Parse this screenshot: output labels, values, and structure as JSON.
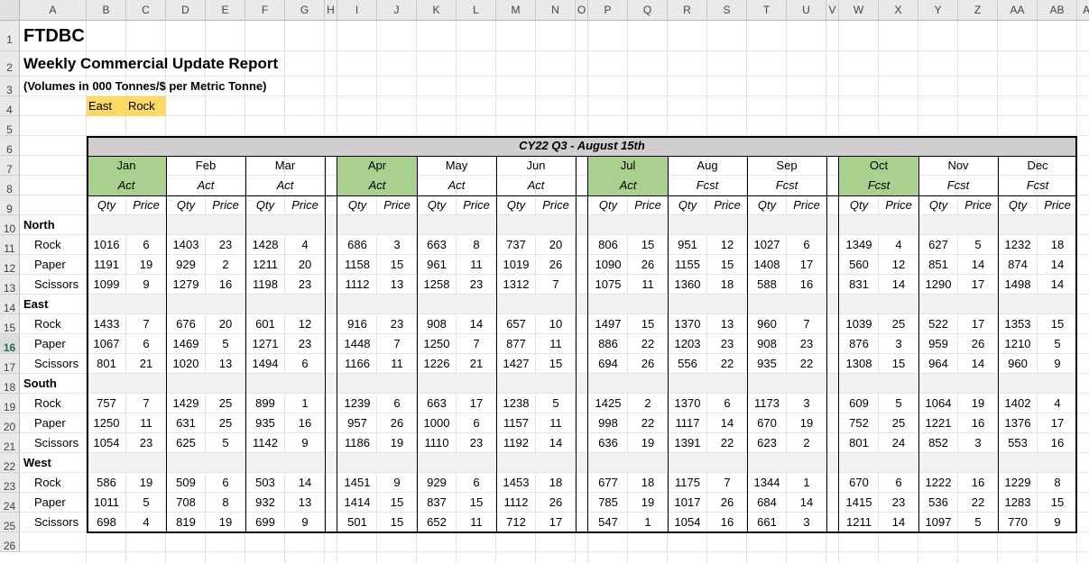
{
  "columns": [
    "A",
    "B",
    "C",
    "D",
    "E",
    "F",
    "G",
    "H",
    "I",
    "J",
    "K",
    "L",
    "M",
    "N",
    "O",
    "P",
    "Q",
    "R",
    "S",
    "T",
    "U",
    "V",
    "W",
    "X",
    "Y",
    "Z",
    "AA",
    "AB",
    "AC"
  ],
  "row_numbers": [
    "1",
    "2",
    "3",
    "4",
    "5",
    "6",
    "7",
    "8",
    "9",
    "10",
    "11",
    "12",
    "13",
    "14",
    "15",
    "16",
    "17",
    "18",
    "19",
    "20",
    "21",
    "22",
    "23",
    "24",
    "25",
    "26"
  ],
  "selected_row": "16",
  "title": "FTDBC",
  "subtitle": "Weekly Commercial Update Report",
  "units_note": "(Volumes in 000 Tonnes/$ per Metric Tonne)",
  "filters": [
    "East",
    "Rock"
  ],
  "banner": "CY22 Q3 - August 15th",
  "months": [
    {
      "name": "Jan",
      "type": "Act",
      "highlight": true
    },
    {
      "name": "Feb",
      "type": "Act",
      "highlight": false
    },
    {
      "name": "Mar",
      "type": "Act",
      "highlight": false
    },
    {
      "name": "Apr",
      "type": "Act",
      "highlight": true
    },
    {
      "name": "May",
      "type": "Act",
      "highlight": false
    },
    {
      "name": "Jun",
      "type": "Act",
      "highlight": false
    },
    {
      "name": "Jul",
      "type": "Act",
      "highlight": true
    },
    {
      "name": "Aug",
      "type": "Fcst",
      "highlight": false
    },
    {
      "name": "Sep",
      "type": "Fcst",
      "highlight": false
    },
    {
      "name": "Oct",
      "type": "Fcst",
      "highlight": true
    },
    {
      "name": "Nov",
      "type": "Fcst",
      "highlight": false
    },
    {
      "name": "Dec",
      "type": "Fcst",
      "highlight": false
    }
  ],
  "qty_label": "Qty",
  "price_label": "Price",
  "regions": [
    {
      "name": "North",
      "rows": [
        {
          "product": "Rock",
          "values": [
            [
              1016,
              6
            ],
            [
              1403,
              23
            ],
            [
              1428,
              4
            ],
            [
              686,
              3
            ],
            [
              663,
              8
            ],
            [
              737,
              20
            ],
            [
              806,
              15
            ],
            [
              951,
              12
            ],
            [
              1027,
              6
            ],
            [
              1349,
              4
            ],
            [
              627,
              5
            ],
            [
              1232,
              18
            ]
          ]
        },
        {
          "product": "Paper",
          "values": [
            [
              1191,
              19
            ],
            [
              929,
              2
            ],
            [
              1211,
              20
            ],
            [
              1158,
              15
            ],
            [
              961,
              11
            ],
            [
              1019,
              26
            ],
            [
              1090,
              26
            ],
            [
              1155,
              15
            ],
            [
              1408,
              17
            ],
            [
              560,
              12
            ],
            [
              851,
              14
            ],
            [
              874,
              14
            ]
          ]
        },
        {
          "product": "Scissors",
          "values": [
            [
              1099,
              9
            ],
            [
              1279,
              16
            ],
            [
              1198,
              23
            ],
            [
              1112,
              13
            ],
            [
              1258,
              23
            ],
            [
              1312,
              7
            ],
            [
              1075,
              11
            ],
            [
              1360,
              18
            ],
            [
              588,
              16
            ],
            [
              831,
              14
            ],
            [
              1290,
              17
            ],
            [
              1498,
              14
            ]
          ]
        }
      ]
    },
    {
      "name": "East",
      "rows": [
        {
          "product": "Rock",
          "values": [
            [
              1433,
              7
            ],
            [
              676,
              20
            ],
            [
              601,
              12
            ],
            [
              916,
              23
            ],
            [
              908,
              14
            ],
            [
              657,
              10
            ],
            [
              1497,
              15
            ],
            [
              1370,
              13
            ],
            [
              960,
              7
            ],
            [
              1039,
              25
            ],
            [
              522,
              17
            ],
            [
              1353,
              15
            ]
          ]
        },
        {
          "product": "Paper",
          "values": [
            [
              1067,
              6
            ],
            [
              1469,
              5
            ],
            [
              1271,
              23
            ],
            [
              1448,
              7
            ],
            [
              1250,
              7
            ],
            [
              877,
              11
            ],
            [
              886,
              22
            ],
            [
              1203,
              23
            ],
            [
              908,
              23
            ],
            [
              876,
              3
            ],
            [
              959,
              26
            ],
            [
              1210,
              5
            ]
          ]
        },
        {
          "product": "Scissors",
          "values": [
            [
              801,
              21
            ],
            [
              1020,
              13
            ],
            [
              1494,
              6
            ],
            [
              1166,
              11
            ],
            [
              1226,
              21
            ],
            [
              1427,
              15
            ],
            [
              694,
              26
            ],
            [
              556,
              22
            ],
            [
              935,
              22
            ],
            [
              1308,
              15
            ],
            [
              964,
              14
            ],
            [
              960,
              9
            ]
          ]
        }
      ]
    },
    {
      "name": "South",
      "rows": [
        {
          "product": "Rock",
          "values": [
            [
              757,
              7
            ],
            [
              1429,
              25
            ],
            [
              899,
              1
            ],
            [
              1239,
              6
            ],
            [
              663,
              17
            ],
            [
              1238,
              5
            ],
            [
              1425,
              2
            ],
            [
              1370,
              6
            ],
            [
              1173,
              3
            ],
            [
              609,
              5
            ],
            [
              1064,
              19
            ],
            [
              1402,
              4
            ]
          ]
        },
        {
          "product": "Paper",
          "values": [
            [
              1250,
              11
            ],
            [
              631,
              25
            ],
            [
              935,
              16
            ],
            [
              957,
              26
            ],
            [
              1000,
              6
            ],
            [
              1157,
              11
            ],
            [
              998,
              22
            ],
            [
              1117,
              14
            ],
            [
              670,
              19
            ],
            [
              752,
              25
            ],
            [
              1221,
              16
            ],
            [
              1376,
              17
            ]
          ]
        },
        {
          "product": "Scissors",
          "values": [
            [
              1054,
              23
            ],
            [
              625,
              5
            ],
            [
              1142,
              9
            ],
            [
              1186,
              19
            ],
            [
              1110,
              23
            ],
            [
              1192,
              14
            ],
            [
              636,
              19
            ],
            [
              1391,
              22
            ],
            [
              623,
              2
            ],
            [
              801,
              24
            ],
            [
              852,
              3
            ],
            [
              553,
              16
            ]
          ]
        }
      ]
    },
    {
      "name": "West",
      "rows": [
        {
          "product": "Rock",
          "values": [
            [
              586,
              19
            ],
            [
              509,
              6
            ],
            [
              503,
              14
            ],
            [
              1451,
              9
            ],
            [
              929,
              6
            ],
            [
              1453,
              18
            ],
            [
              677,
              18
            ],
            [
              1175,
              7
            ],
            [
              1344,
              1
            ],
            [
              670,
              6
            ],
            [
              1222,
              16
            ],
            [
              1229,
              8
            ]
          ]
        },
        {
          "product": "Paper",
          "values": [
            [
              1011,
              5
            ],
            [
              708,
              8
            ],
            [
              932,
              13
            ],
            [
              1414,
              15
            ],
            [
              837,
              15
            ],
            [
              1112,
              26
            ],
            [
              785,
              19
            ],
            [
              1017,
              26
            ],
            [
              684,
              14
            ],
            [
              1415,
              23
            ],
            [
              536,
              22
            ],
            [
              1283,
              15
            ]
          ]
        },
        {
          "product": "Scissors",
          "values": [
            [
              698,
              4
            ],
            [
              819,
              19
            ],
            [
              699,
              9
            ],
            [
              501,
              15
            ],
            [
              652,
              11
            ],
            [
              712,
              17
            ],
            [
              547,
              1
            ],
            [
              1054,
              16
            ],
            [
              661,
              3
            ],
            [
              1211,
              14
            ],
            [
              1097,
              5
            ],
            [
              770,
              9
            ]
          ]
        }
      ]
    }
  ]
}
